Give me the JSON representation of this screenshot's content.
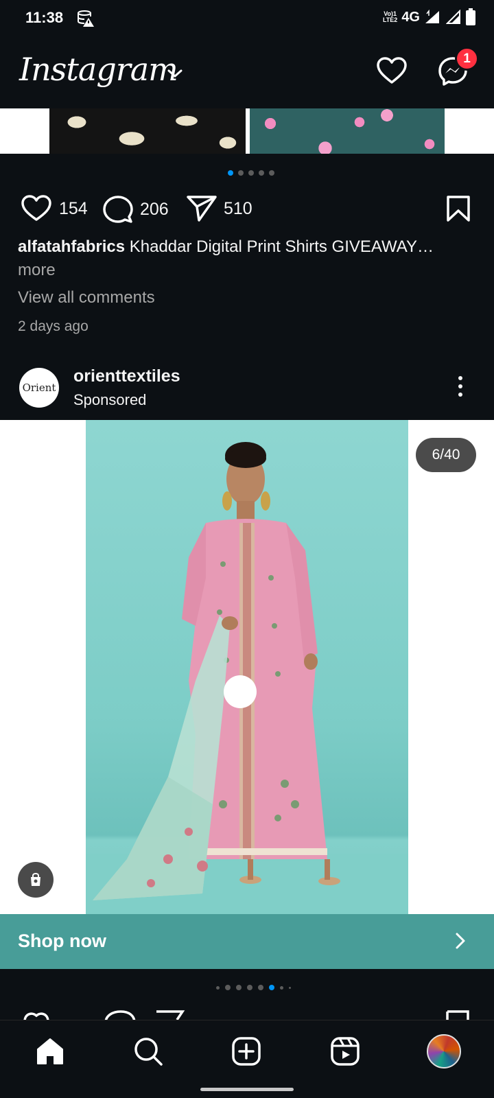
{
  "status_bar": {
    "time": "11:38",
    "network": "4G",
    "volte": "VoLTE2",
    "icons": [
      "data-saver-icon",
      "volte-icon",
      "signal-icon",
      "signal-icon",
      "battery-icon"
    ]
  },
  "header": {
    "logo": "Instagram",
    "notification_count": "1",
    "icons": [
      "chevron-down-icon",
      "heart-icon",
      "messenger-icon"
    ]
  },
  "previous_post": {
    "carousel_dots": 5,
    "carousel_active": 0,
    "likes": "154",
    "comments": "206",
    "shares": "510",
    "caption_user": "alfatahfabrics",
    "caption_text": "Khaddar Digital Print Shirts GIVEAWAY…",
    "caption_more": "more",
    "view_comments": "View all comments",
    "time_ago": "2 days ago"
  },
  "sponsored_post": {
    "avatar_text": "Orient",
    "username": "orienttextiles",
    "label": "Sponsored",
    "media_counter": "6/40",
    "cta_label": "Shop now",
    "carousel_active": 5,
    "carousel_dots": 8
  },
  "colors": {
    "background": "#0c1014",
    "accent": "#0095f6",
    "badge": "#ff3040",
    "cta_background": "#489d98",
    "photo_backdrop": "#8ed6d1"
  },
  "bottom_nav": {
    "items": [
      "home-icon",
      "search-icon",
      "create-icon",
      "reels-icon",
      "profile-avatar"
    ]
  }
}
